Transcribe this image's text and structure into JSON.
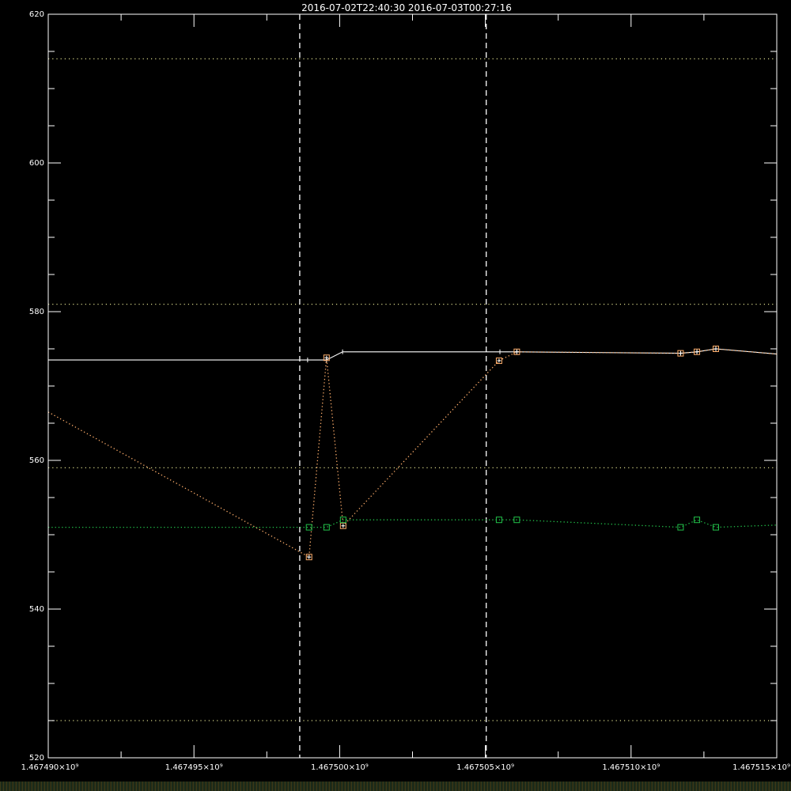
{
  "header": {
    "time_range": "2016-07-02T22:40:30  2016-07-03T00:27:16"
  },
  "colors": {
    "background": "#000000",
    "axis": "#ffffff",
    "series_white": "#ffffff",
    "series_orange": "#ffae6b",
    "series_green": "#22c24a",
    "reference": "#d8d88a"
  },
  "chart_data": {
    "type": "line",
    "title": "2016-07-02T22:40:30  2016-07-03T00:27:16",
    "xlabel": "",
    "ylabel": "",
    "xlim": [
      1467490000,
      1467515000
    ],
    "ylim": [
      520,
      620
    ],
    "x_ticks": [
      1467490000,
      1467495000,
      1467500000,
      1467505000,
      1467510000,
      1467515000
    ],
    "x_tick_labels": [
      "1.467490×10⁹",
      "1.467495×10⁹",
      "1.467500×10⁹",
      "1.467505×10⁹",
      "1.467510×10⁹",
      "1.467515×10⁹"
    ],
    "y_ticks": [
      520,
      540,
      560,
      580,
      600,
      620
    ],
    "y_tick_labels": [
      "520",
      "540",
      "560",
      "580",
      "600",
      "620"
    ],
    "grid": false,
    "vertical_markers": [
      1467498630,
      1467505030
    ],
    "reference_lines": [
      614,
      581,
      559,
      525
    ],
    "series": [
      {
        "style": "solid",
        "color": "#ffffff",
        "x": [
          1467490000,
          1467498900,
          1467499550,
          1467500100,
          1467505500,
          1467506080,
          1467511700,
          1467512260,
          1467512910,
          1467515000
        ],
        "y": [
          573.5,
          573.5,
          573.5,
          574.6,
          574.6,
          574.6,
          574.4,
          574.6,
          575.0,
          574.3
        ]
      },
      {
        "style": "dotted",
        "color": "#ffae6b",
        "x": [
          1467490000,
          1467498950,
          1467499550,
          1467500120,
          1467505470,
          1467506080,
          1467511700,
          1467512260,
          1467512910,
          1467515000
        ],
        "y": [
          566.5,
          547.0,
          573.8,
          551.2,
          573.4,
          574.6,
          574.4,
          574.6,
          575.0,
          574.3
        ],
        "markers": [
          1,
          2,
          3,
          4,
          5,
          6,
          7,
          8
        ]
      },
      {
        "style": "dotted",
        "color": "#22c24a",
        "x": [
          1467490000,
          1467498950,
          1467499550,
          1467500120,
          1467505470,
          1467506080,
          1467511700,
          1467512260,
          1467512910,
          1467515000
        ],
        "y": [
          551.0,
          551.0,
          551.0,
          552.0,
          552.0,
          552.0,
          551.0,
          552.0,
          551.0,
          551.3
        ],
        "markers": [
          1,
          2,
          3,
          4,
          5,
          6,
          7,
          8
        ]
      }
    ]
  }
}
